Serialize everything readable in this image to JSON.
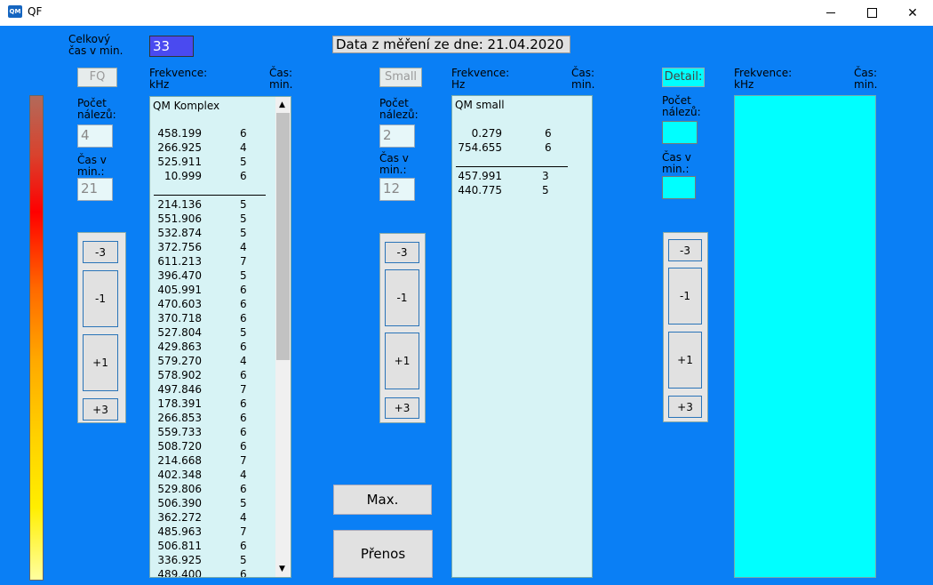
{
  "window": {
    "title": "QF",
    "icon": "QM"
  },
  "header": {
    "total_time_label": "Celkový čas v min.",
    "total_time_value": "33",
    "date_label": "Data z měření ze dne: 21.04.2020"
  },
  "panels": {
    "fq": {
      "mode_label": "FQ",
      "freq_header": "Frekvence: kHz",
      "time_header": "Čas: min.",
      "count_label": "Počet nálezů:",
      "count_value": "4",
      "time_label": "Čas v min.:",
      "time_value": "21",
      "steps": [
        "-3",
        "-1",
        "+1",
        "+3"
      ],
      "list_title": "QM Komplex",
      "top_rows": [
        {
          "f": "458.199",
          "t": "6"
        },
        {
          "f": "266.925",
          "t": "4"
        },
        {
          "f": "525.911",
          "t": "5"
        },
        {
          "f": "10.999",
          "t": "6"
        }
      ],
      "bottom_rows": [
        {
          "f": "214.136",
          "t": "5"
        },
        {
          "f": "551.906",
          "t": "5"
        },
        {
          "f": "532.874",
          "t": "5"
        },
        {
          "f": "372.756",
          "t": "4"
        },
        {
          "f": "611.213",
          "t": "7"
        },
        {
          "f": "396.470",
          "t": "5"
        },
        {
          "f": "405.991",
          "t": "6"
        },
        {
          "f": "470.603",
          "t": "6"
        },
        {
          "f": "370.718",
          "t": "6"
        },
        {
          "f": "527.804",
          "t": "5"
        },
        {
          "f": "429.863",
          "t": "6"
        },
        {
          "f": "579.270",
          "t": "4"
        },
        {
          "f": "578.902",
          "t": "6"
        },
        {
          "f": "497.846",
          "t": "7"
        },
        {
          "f": "178.391",
          "t": "6"
        },
        {
          "f": "266.853",
          "t": "6"
        },
        {
          "f": "559.733",
          "t": "6"
        },
        {
          "f": "508.720",
          "t": "6"
        },
        {
          "f": "214.668",
          "t": "7"
        },
        {
          "f": "402.348",
          "t": "4"
        },
        {
          "f": "529.806",
          "t": "6"
        },
        {
          "f": "506.390",
          "t": "5"
        },
        {
          "f": "362.272",
          "t": "4"
        },
        {
          "f": "485.963",
          "t": "7"
        },
        {
          "f": "506.811",
          "t": "6"
        },
        {
          "f": "336.925",
          "t": "5"
        },
        {
          "f": "489.400",
          "t": "6"
        }
      ]
    },
    "small": {
      "mode_label": "Small",
      "freq_header": "Frekvence: Hz",
      "time_header": "Čas: min.",
      "count_label": "Počet nálezů:",
      "count_value": "2",
      "time_label": "Čas v min.:",
      "time_value": "12",
      "steps": [
        "-3",
        "-1",
        "+1",
        "+3"
      ],
      "list_title": "QM small",
      "top_rows": [
        {
          "f": "0.279",
          "t": "6"
        },
        {
          "f": "754.655",
          "t": "6"
        }
      ],
      "bottom_rows": [
        {
          "f": "457.991",
          "t": "3"
        },
        {
          "f": "440.775",
          "t": "5"
        }
      ]
    },
    "detail": {
      "mode_label": "Detail:",
      "freq_header": "Frekvence: kHz",
      "time_header": "Čas: min.",
      "count_label": "Počet nálezů:",
      "time_label": "Čas v min.:",
      "steps": [
        "-3",
        "-1",
        "+1",
        "+3"
      ]
    }
  },
  "actions": {
    "max_label": "Max.",
    "transfer_label": "Přenos"
  },
  "colors": {
    "background": "#0a7ff5",
    "list": "#d7f3f5",
    "accent": "#00ffff"
  }
}
